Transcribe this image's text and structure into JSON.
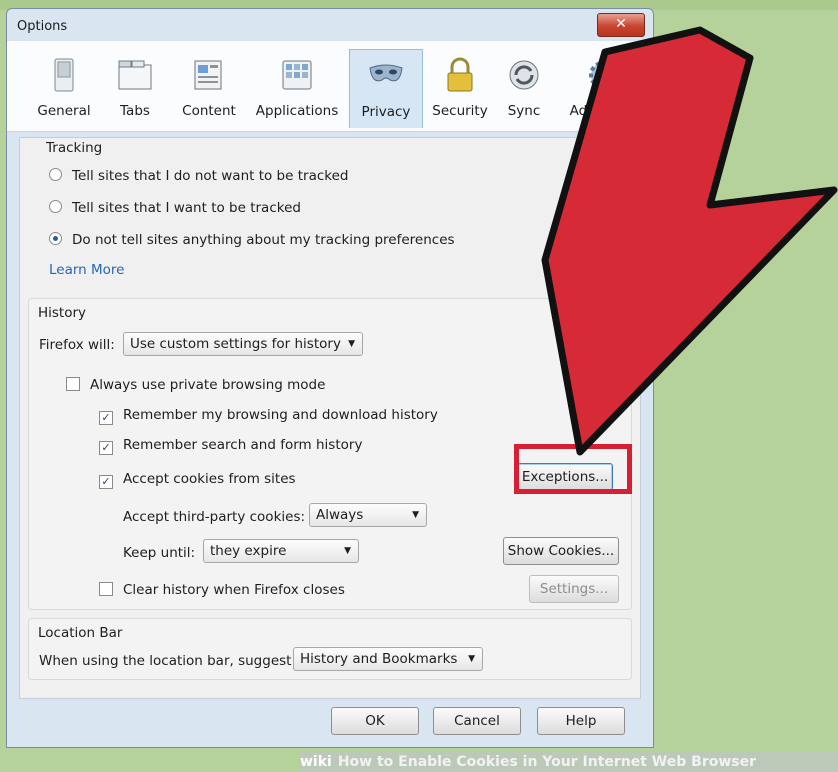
{
  "window": {
    "title": "Options",
    "close_label": "✕"
  },
  "tabs": [
    {
      "label": "General",
      "icon": "general-switch-icon"
    },
    {
      "label": "Tabs",
      "icon": "tabs-icon"
    },
    {
      "label": "Content",
      "icon": "content-icon"
    },
    {
      "label": "Applications",
      "icon": "applications-icon"
    },
    {
      "label": "Privacy",
      "icon": "privacy-mask-icon",
      "active": true
    },
    {
      "label": "Security",
      "icon": "security-lock-icon"
    },
    {
      "label": "Sync",
      "icon": "sync-icon"
    },
    {
      "label": "Advanced",
      "icon": "advanced-gear-icon"
    }
  ],
  "tracking": {
    "title": "Tracking",
    "opt1": "Tell sites that I do not want to be tracked",
    "opt2": "Tell sites that I want to be tracked",
    "opt3": "Do not tell sites anything about my tracking preferences",
    "selected": 3,
    "learn_more": "Learn More"
  },
  "history": {
    "title": "History",
    "firefox_will_label": "Firefox will:",
    "firefox_will_value": "Use custom settings for history",
    "private_mode": "Always use private browsing mode",
    "remember_browsing": "Remember my browsing and download history",
    "remember_search": "Remember search and form history",
    "accept_cookies": "Accept cookies from sites",
    "exceptions_button": "Exceptions...",
    "third_party_label": "Accept third-party cookies:",
    "third_party_value": "Always",
    "keep_until_label": "Keep until:",
    "keep_until_value": "they expire",
    "show_cookies_button": "Show Cookies...",
    "clear_history": "Clear history when Firefox closes",
    "settings_button": "Settings..."
  },
  "location_bar": {
    "title": "Location Bar",
    "suggest_label": "When using the location bar, suggest:",
    "suggest_value": "History and Bookmarks"
  },
  "footer": {
    "ok": "OK",
    "cancel": "Cancel",
    "help": "Help"
  },
  "caption": {
    "brand": "wiki",
    "text": "How to Enable Cookies in Your Internet Web Browser"
  },
  "colors": {
    "highlight": "#d61f32",
    "arrow": "#d62a36",
    "accent": "#2467b5"
  }
}
